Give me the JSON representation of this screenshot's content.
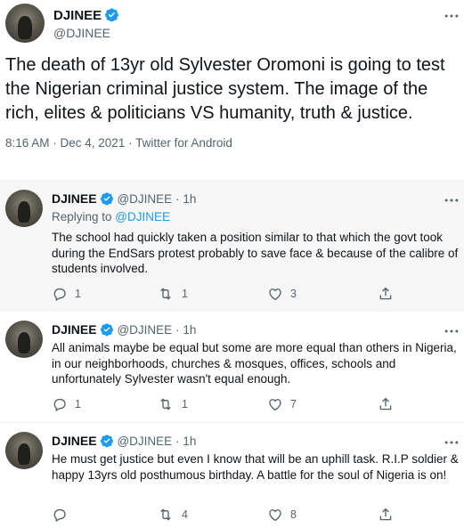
{
  "main_tweet": {
    "name": "DJINEE",
    "handle": "@DJINEE",
    "text": "The death of 13yr old Sylvester Oromoni is going to test the Nigerian criminal justice system. The image of the rich, elites & politicians VS humanity, truth & justice.",
    "meta": "8:16 AM · Dec 4, 2021 · Twitter for Android"
  },
  "replies": [
    {
      "name": "DJINEE",
      "handle": "@DJINEE",
      "time": "· 1h",
      "replying_prefix": "Replying to ",
      "replying_to": "@DJINEE",
      "text": "The school had quickly taken a position similar to that which the govt took during the EndSars protest probably to save face & because of the calibre of students involved.",
      "reply_count": "1",
      "retweet_count": "1",
      "like_count": "3",
      "share_count": ""
    },
    {
      "name": "DJINEE",
      "handle": "@DJINEE",
      "time": "· 1h",
      "text": "All animals maybe be equal but some are more equal than others in Nigeria, in our neighborhoods, churches & mosques, offices, schools and unfortunately Sylvester wasn't equal enough.",
      "reply_count": "1",
      "retweet_count": "1",
      "like_count": "7",
      "share_count": ""
    },
    {
      "name": "DJINEE",
      "handle": "@DJINEE",
      "time": "· 1h",
      "text": "He must get justice but even I know that will be an uphill task. R.I.P soldier & happy 13yrs old posthumous birthday. A battle for the soul of Nigeria is on!",
      "reply_count": "",
      "retweet_count": "4",
      "like_count": "8",
      "share_count": ""
    }
  ],
  "colors": {
    "verified": "#1d9bf0",
    "text": "#0f1419",
    "secondary": "#536471",
    "link": "#1d9bf0",
    "highlight_bg": "#f7f7f7"
  },
  "icons": {
    "verified": "verified-badge-icon",
    "more": "more-horizontal-icon",
    "reply": "reply-bubble-icon",
    "retweet": "retweet-icon",
    "like": "heart-icon",
    "share": "share-icon"
  }
}
